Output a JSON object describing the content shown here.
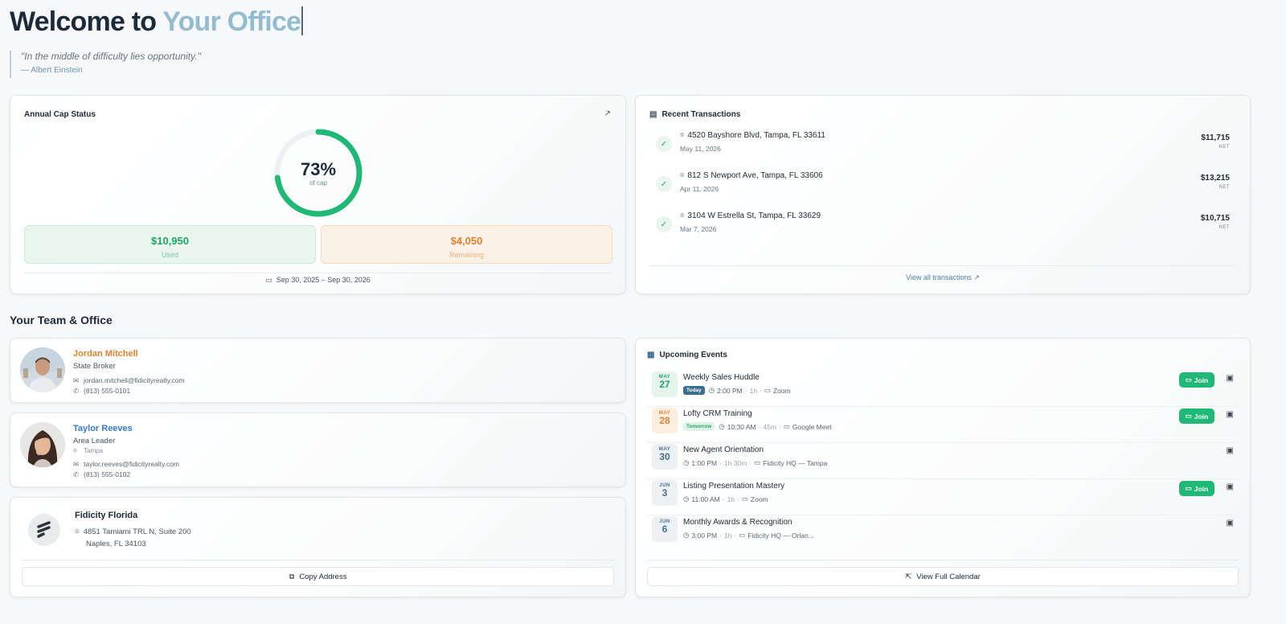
{
  "hero": {
    "title_prefix": "Welcome to ",
    "title_accent": "Your Office"
  },
  "quote": {
    "text": "\"In the middle of difficulty lies opportunity.\"",
    "author": "— Albert Einstein"
  },
  "cap": {
    "title": "Annual Cap Status",
    "percent_text": "73%",
    "percent_value": 73,
    "percent_sub": "of cap",
    "used_value": "$10,950",
    "used_label": "Used",
    "remaining_value": "$4,050",
    "remaining_label": "Remaining",
    "period": "Sep 30, 2025 – Sep 30, 2026",
    "colors": {
      "ring": "#1fb877",
      "used": "#1fa666",
      "remaining": "#dd8230"
    }
  },
  "transactions": {
    "title": "Recent Transactions",
    "items": [
      {
        "address": "4520 Bayshore Blvd, Tampa, FL 33611",
        "date": "May 11, 2026",
        "amount": "$11,715",
        "amount_label": "NET"
      },
      {
        "address": "812 S Newport Ave, Tampa, FL 33606",
        "date": "Apr 11, 2026",
        "amount": "$13,215",
        "amount_label": "NET"
      },
      {
        "address": "3104 W Estrella St, Tampa, FL 33629",
        "date": "Mar 7, 2026",
        "amount": "$10,715",
        "amount_label": "NET"
      }
    ],
    "view_all": "View all transactions"
  },
  "team": {
    "heading": "Your Team & Office",
    "people": [
      {
        "name": "Jordan Mitchell",
        "role": "State Broker",
        "email": "jordan.mitchell@fidicityrealty.com",
        "phone": "(813) 555-0101",
        "name_color": "#dd8230"
      },
      {
        "name": "Taylor Reeves",
        "role": "Area Leader",
        "location": "Tampa",
        "email": "taylor.reeves@fidicityrealty.com",
        "phone": "(813) 555-0102",
        "name_color": "#3a78c9"
      }
    ],
    "office": {
      "name": "Fidicity Florida",
      "address_line1": "4851 Tamiami TRL N, Suite 200",
      "address_line2": "Naples, FL 34103",
      "copy_label": "Copy Address"
    }
  },
  "events": {
    "title": "Upcoming Events",
    "items": [
      {
        "month": "MAY",
        "day": "27",
        "title": "Weekly Sales Huddle",
        "tag": "Today",
        "time": "2:00 PM",
        "duration": "1h",
        "location": "Zoom",
        "join": "Join"
      },
      {
        "month": "MAY",
        "day": "28",
        "title": "Lofty CRM Training",
        "tag": "Tomorrow",
        "time": "10:30 AM",
        "duration": "45m",
        "location": "Google Meet",
        "join": "Join"
      },
      {
        "month": "MAY",
        "day": "30",
        "title": "New Agent Orientation",
        "time": "1:00 PM",
        "duration": "1h 30m",
        "location": "Fidicity HQ — Tampa"
      },
      {
        "month": "JUN",
        "day": "3",
        "title": "Listing Presentation Mastery",
        "time": "11:00 AM",
        "duration": "1h",
        "location": "Zoom",
        "join": "Join"
      },
      {
        "month": "JUN",
        "day": "6",
        "title": "Monthly Awards & Recognition",
        "time": "3:00 PM",
        "duration": "1h",
        "location": "Fidicity HQ — Orlan..."
      }
    ],
    "calendar_label": "View Full Calendar"
  }
}
